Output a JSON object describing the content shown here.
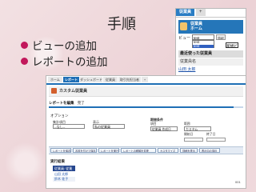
{
  "slide": {
    "title": "手順",
    "bullets": [
      "ビューの追加",
      "レポートの追加"
    ],
    "bullet_color": "#c2185b"
  },
  "screenshot1": {
    "tabs": [
      "従業員",
      "+"
    ],
    "header": "従業員\nホーム",
    "view_label": "ビュー",
    "selected_view": "test",
    "options": [
      "test",
      "test"
    ],
    "go_button": "Go!",
    "new_view_button": "新規ビュー",
    "recent_label": "最近使った従業員",
    "column_header": "従業員名",
    "rows": [
      "山田 太郎"
    ],
    "accent_color": "#2576b9"
  },
  "screenshot2": {
    "tabs": [
      "ホーム",
      "レポート",
      "ダッシュボード",
      "従業員",
      "取引先担当者",
      "+"
    ],
    "active_tab": "レポート",
    "header_title": "カスタム従業員",
    "steps": [
      "レポートを編集",
      "完了"
    ],
    "progress": 0.95,
    "options_label": "オプション",
    "selects": [
      {
        "label": "集計項目",
        "value": "--なし--"
      },
      {
        "label": "表示",
        "value": "私の従業員"
      }
    ],
    "time_filter_label": "期間条件",
    "period_label": "項目",
    "period_value": "従業員 作成日",
    "range_label": "範囲",
    "range_value": "カスタム",
    "from_label": "開始日",
    "to_label": "終了日",
    "toolbar_buttons": [
      "レポートを保存",
      "名前を付けて保存",
      "レポートを実行",
      "レポートの種類を変更",
      "カスタマイズ",
      "詳細を表示",
      "表示中の項目"
    ],
    "preview_label": "実行結果",
    "preview_header": "従業員: 従業員名",
    "preview_rows": [
      "山田 太郎",
      "鈴木 花子"
    ],
    "page_number": "001",
    "accent_color": "#1f6fb6"
  }
}
